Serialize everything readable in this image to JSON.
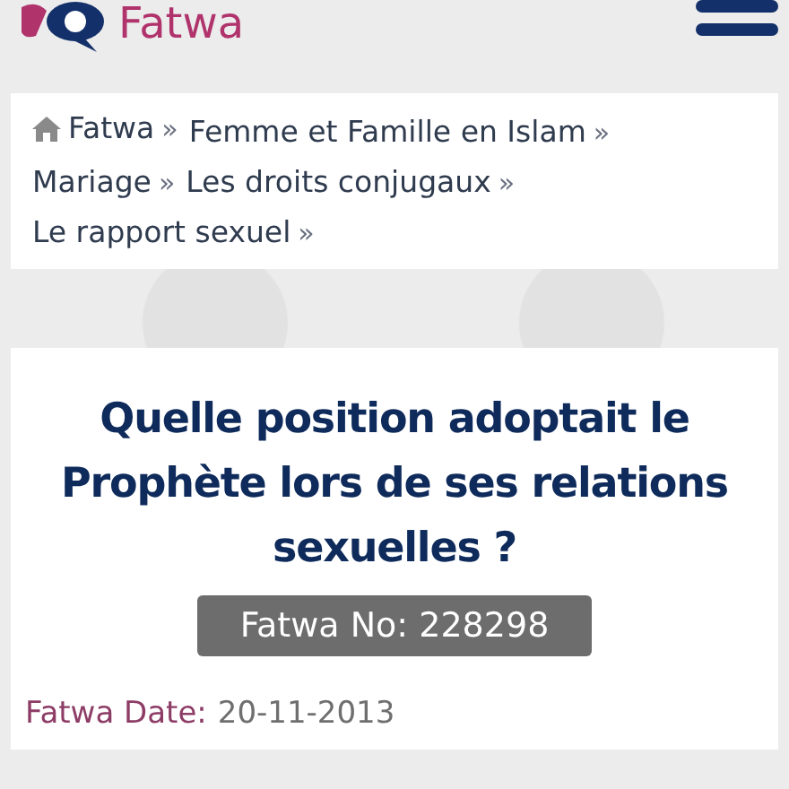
{
  "header": {
    "logo_text": "Fatwa"
  },
  "breadcrumbs": [
    {
      "label": "Fatwa",
      "separator": "»",
      "kind": "home"
    },
    {
      "label": "Femme et Famille en Islam",
      "separator": "»",
      "kind": "link"
    },
    {
      "label": "Mariage",
      "separator": "»",
      "kind": "link"
    },
    {
      "label": "Les droits conjugaux",
      "separator": "»",
      "kind": "link"
    },
    {
      "label": "Le rapport sexuel",
      "separator": "»",
      "kind": "link"
    }
  ],
  "article": {
    "title": "Quelle position adoptait le Prophète lors de ses relations sexuelles ?",
    "fatwa_number": "Fatwa No: 228298",
    "date_label": "Fatwa Date:",
    "date_value": "20-11-2013"
  }
}
